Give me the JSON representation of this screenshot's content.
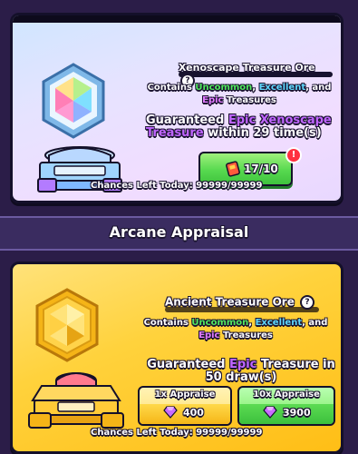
{
  "card1": {
    "title": "Xenoscape Treasure Ore",
    "help": "?",
    "contains_prefix": "Contains ",
    "uncommon": "Uncommon",
    "comma": ", ",
    "excellent": "Excellent",
    "and": ", and",
    "epic": "Epic",
    "treasures": " Treasures",
    "guar_line1_a": "Guaranteed ",
    "guar_line1_b": "Epic Xenoscape",
    "guar_line2_a": "Treasure",
    "guar_line2_b": " within 29 time(s)",
    "button_count": "17/10",
    "badge": "!",
    "chances": "Chances Left Today: 99999/99999"
  },
  "section": {
    "title": "Arcane Appraisal"
  },
  "card2": {
    "title": "Ancient Treasure Ore",
    "help": "?",
    "contains_prefix": "Contains ",
    "uncommon": "Uncommon",
    "comma": ", ",
    "excellent": "Excellent",
    "and": ", and",
    "epic": "Epic",
    "treasures": " Treasures",
    "guar_line1_a": "Guaranteed ",
    "guar_line1_b": "Epic",
    "guar_line1_c": " Treasure in",
    "guar_line2": "50 draw(s)",
    "btn1_label": "1x Appraise",
    "btn1_amount": "400",
    "btn2_label": "10x Appraise",
    "btn2_amount": "3900",
    "chances": "Chances Left Today: 99999/99999"
  },
  "colors": {
    "uncommon": "#52e85f",
    "excellent": "#5fd8ff",
    "epic": "#c065ff"
  },
  "icons": [
    "hex-crystal-icon",
    "pedestal-icon",
    "ticket-icon",
    "gold-hex-icon",
    "gem-icon",
    "question-icon"
  ]
}
